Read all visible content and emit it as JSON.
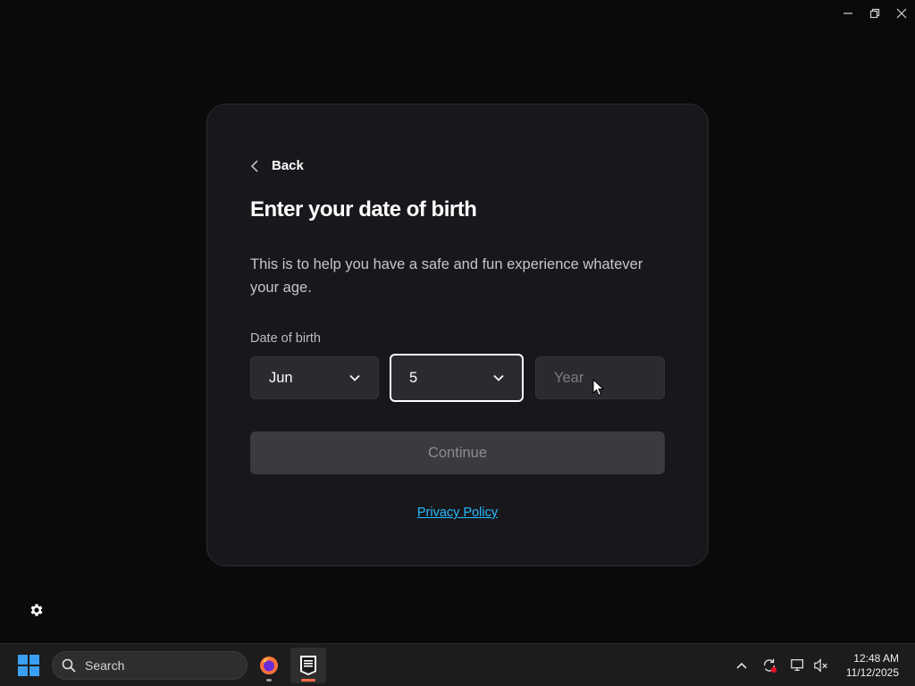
{
  "card": {
    "back_label": "Back",
    "title": "Enter your date of birth",
    "description": "This is to help you have a safe and fun experience whatever your age.",
    "dob_label": "Date of birth",
    "month_value": "Jun",
    "day_value": "5",
    "year_placeholder": "Year",
    "continue_label": "Continue",
    "privacy_label": "Privacy Policy"
  },
  "taskbar": {
    "search_placeholder": "Search",
    "time": "12:48 AM",
    "date": "11/12/2025",
    "apps": [
      "firefox-icon",
      "epic-games-icon"
    ]
  },
  "colors": {
    "background": "#0a0a0a",
    "card": "#18181c",
    "field": "#2a2a2f",
    "link": "#26bbff",
    "button_disabled": "#3a3a3f"
  }
}
